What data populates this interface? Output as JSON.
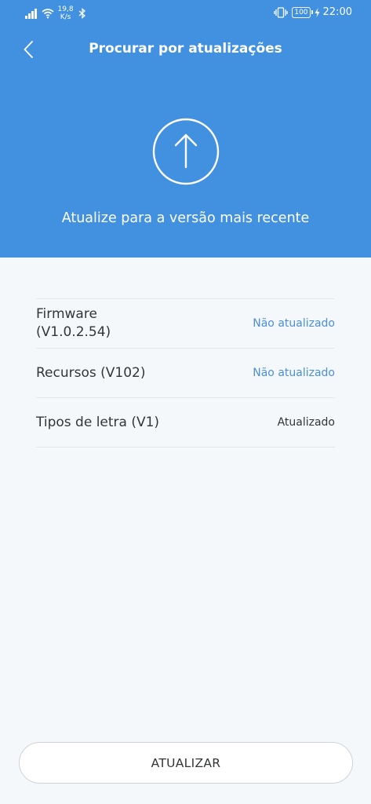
{
  "status_bar": {
    "speed_value": "19,8",
    "speed_unit": "K/s",
    "battery": "100",
    "time": "22:00"
  },
  "header": {
    "title": "Procurar por atualizações",
    "subtitle": "Atualize para a versão mais recente"
  },
  "items": [
    {
      "name": "Firmware (V1.0.2.54)",
      "status": "Não atualizado",
      "state": "pending"
    },
    {
      "name": "Recursos (V102)",
      "status": "Não atualizado",
      "state": "pending"
    },
    {
      "name": "Tipos de letra (V1)",
      "status": "Atualizado",
      "state": "done"
    }
  ],
  "button": {
    "label": "ATUALIZAR"
  },
  "colors": {
    "header_bg": "#4291e0",
    "accent": "#4a8fd9",
    "page_bg": "#f5f8fb"
  }
}
